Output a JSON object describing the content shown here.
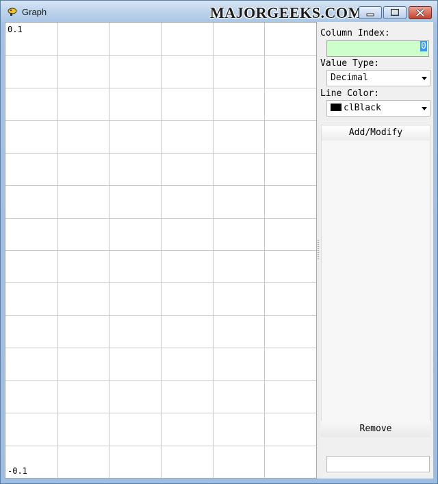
{
  "window": {
    "title": "Graph",
    "watermark": "MAJORGEEKS.COM"
  },
  "graph": {
    "y_max": "0.1",
    "y_min": "-0.1",
    "grid": {
      "columns": 6,
      "rows": 14
    },
    "grid_color": "#c8c8c8"
  },
  "panel": {
    "column_index_label": "Column Index:",
    "column_index_value": "0",
    "value_type_label": "Value Type:",
    "value_type_selected": "Decimal",
    "line_color_label": "Line Color:",
    "line_color_selected": "clBlack",
    "line_color_swatch": "#000000",
    "add_modify_label": "Add/Modify",
    "remove_label": "Remove"
  },
  "colors": {
    "column_index_bg": "#ccffcc",
    "selection": "#3399ff"
  }
}
